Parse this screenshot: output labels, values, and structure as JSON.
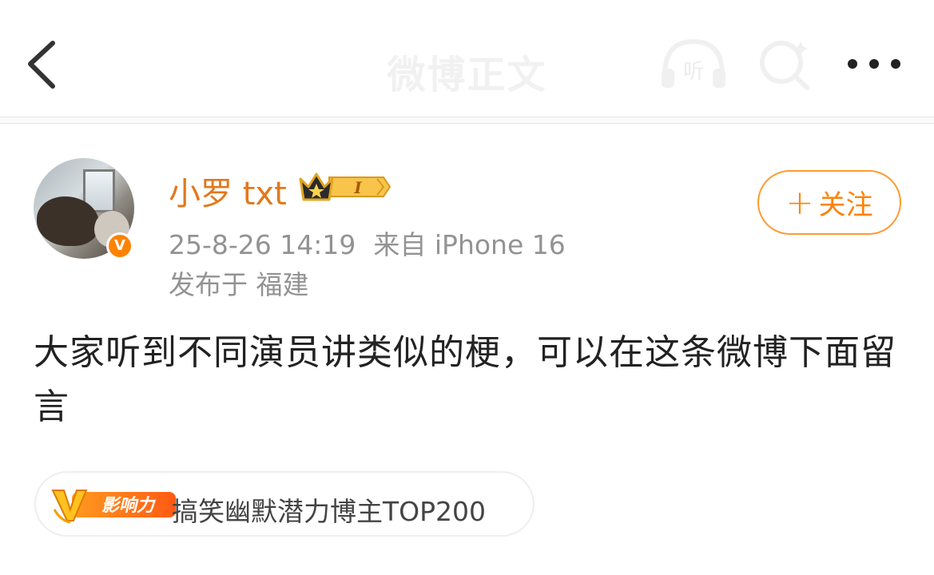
{
  "header": {
    "title": "微博正文",
    "listen_label": "听"
  },
  "author": {
    "name": "小罗 txt",
    "level_badge": "I",
    "verified_mark": "V",
    "timestamp": "25-8-26 14:19",
    "source": "来自 iPhone 16",
    "location": "发布于 福建"
  },
  "follow": {
    "plus": "+",
    "label": "关注"
  },
  "post": {
    "text": "大家听到不同演员讲类似的梗，可以在这条微博下面留言"
  },
  "influence": {
    "badge_text": "影响力",
    "label": "搞笑幽默潜力博主TOP200"
  },
  "colors": {
    "accent": "#ff8200",
    "username": "#e2781c",
    "meta": "#939393"
  },
  "icons": [
    "back-arrow-icon",
    "listen-icon",
    "search-icon",
    "more-icon",
    "crown-icon",
    "verified-icon",
    "influence-icon"
  ]
}
